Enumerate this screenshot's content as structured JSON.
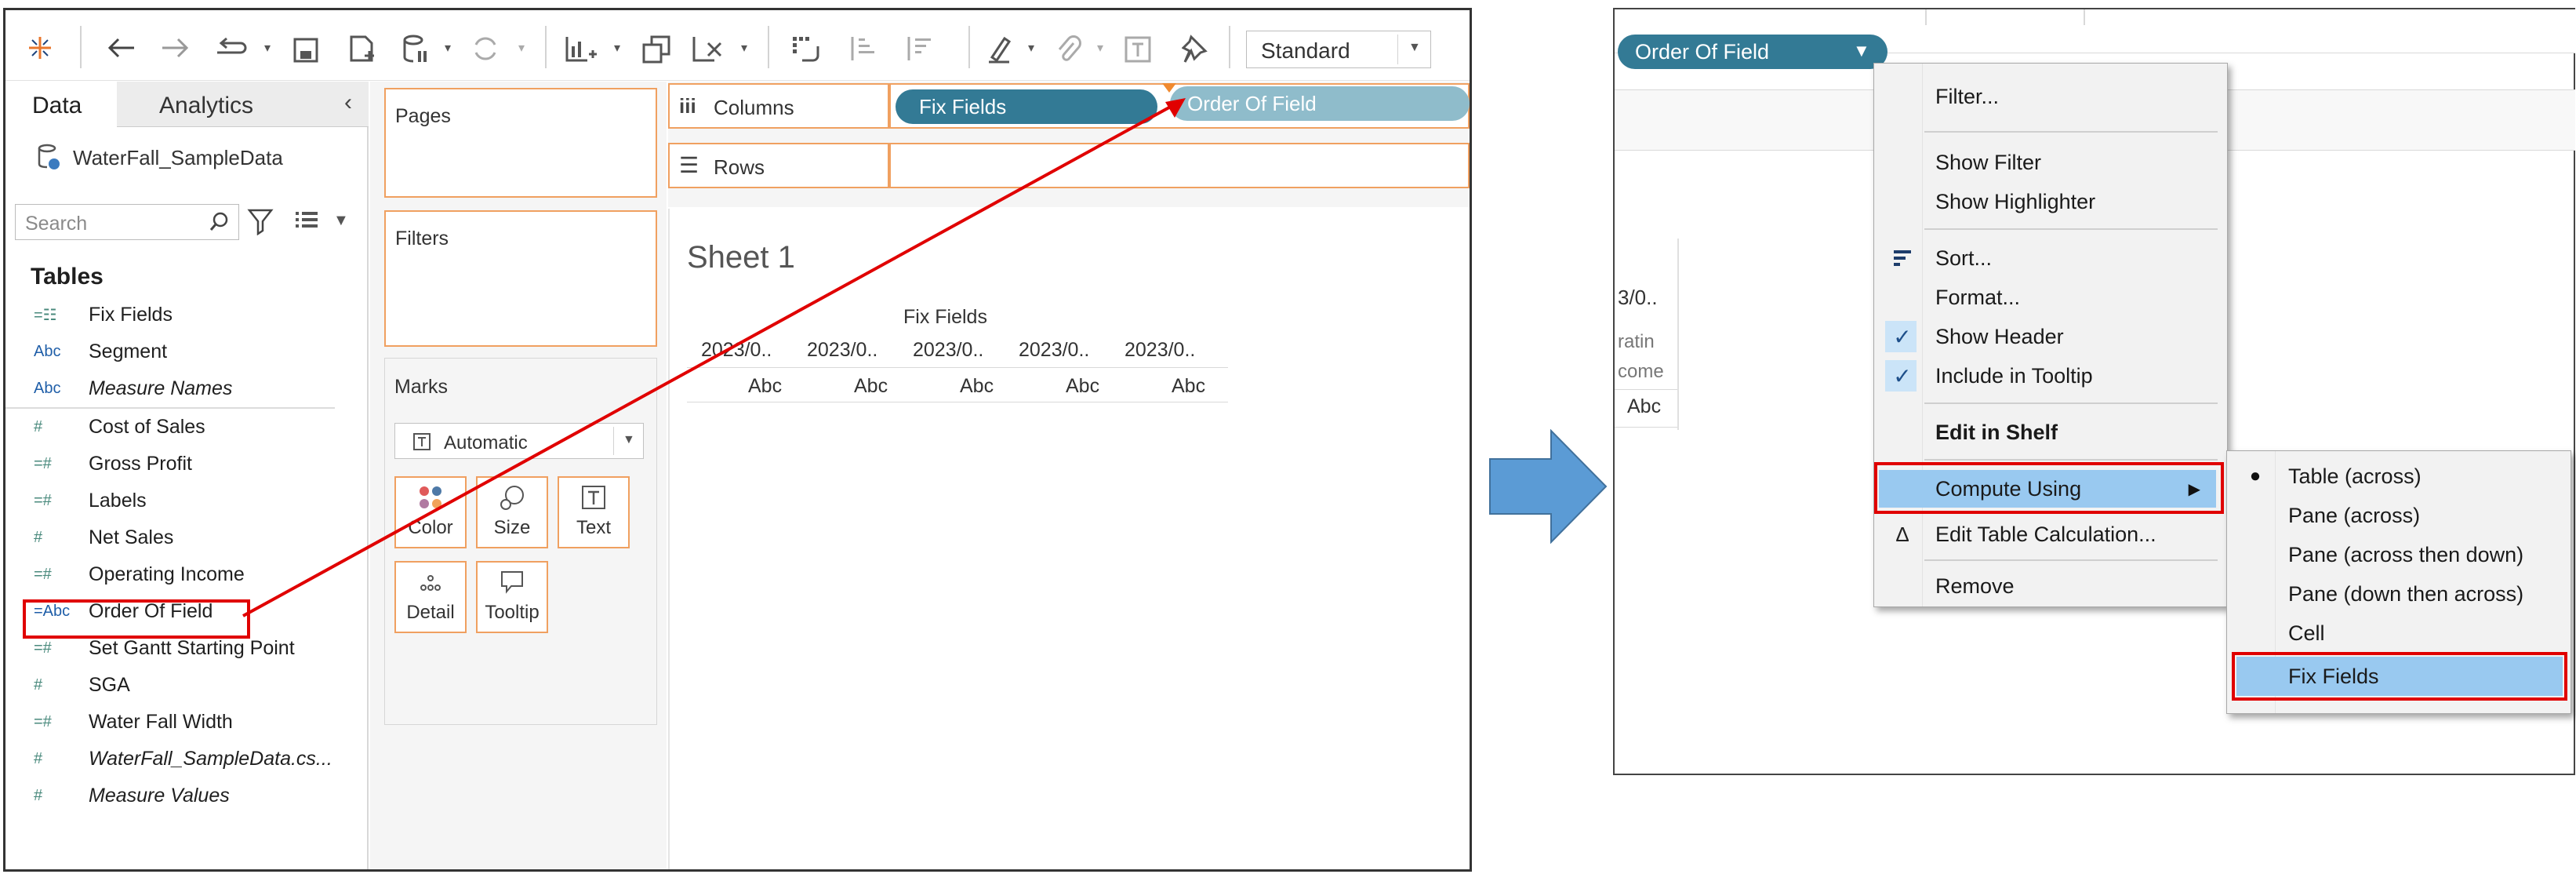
{
  "left_window": {
    "toolbar": {
      "view_select": "Standard",
      "icons": [
        "tableau-logo-icon",
        "back-icon",
        "forward-icon",
        "redo-icon",
        "save-icon",
        "new-datasource-icon",
        "pause-icon",
        "refresh-icon",
        "new-sheet-icon",
        "duplicate-icon",
        "clear-icon",
        "swap-icon",
        "sort-asc-icon",
        "sort-desc-icon",
        "highlight-icon",
        "paperclip-icon",
        "label-icon",
        "pin-icon"
      ]
    },
    "data_pane": {
      "tabs": [
        "Data",
        "Analytics"
      ],
      "datasource": "WaterFall_SampleData",
      "search_placeholder": "Search",
      "tables_heading": "Tables",
      "fields": [
        {
          "icon": "=☷",
          "name": "Fix Fields"
        },
        {
          "icon": "Abc",
          "name": "Segment"
        },
        {
          "icon": "Abc",
          "name": "Measure Names"
        },
        {
          "icon": "#",
          "name": "Cost of Sales"
        },
        {
          "icon": "=#",
          "name": "Gross Profit"
        },
        {
          "icon": "=#",
          "name": "Labels"
        },
        {
          "icon": "#",
          "name": "Net Sales"
        },
        {
          "icon": "=#",
          "name": "Operating Income"
        },
        {
          "icon": "=Abc",
          "name": "Order Of Field"
        },
        {
          "icon": "=#",
          "name": "Set Gantt Starting Point"
        },
        {
          "icon": "#",
          "name": "SGA"
        },
        {
          "icon": "=#",
          "name": "Water Fall Width"
        },
        {
          "icon": "#",
          "name": "WaterFall_SampleData.cs..."
        },
        {
          "icon": "#",
          "name": "Measure Values"
        }
      ]
    },
    "cards": {
      "pages": "Pages",
      "filters": "Filters",
      "marks": "Marks",
      "mark_type": "Automatic",
      "mark_buttons": [
        "Color",
        "Size",
        "Text",
        "Detail",
        "Tooltip"
      ]
    },
    "shelves": {
      "columns_label": "Columns",
      "rows_label": "Rows",
      "columns_pill": "Fix Fields",
      "dragged_pill": "Order Of Field"
    },
    "sheet": {
      "title": "Sheet 1",
      "header": "Fix Fields",
      "col_headers": [
        "2023/0..",
        "2023/0..",
        "2023/0..",
        "2023/0..",
        "2023/0.."
      ],
      "cells": [
        "Abc",
        "Abc",
        "Abc",
        "Abc",
        "Abc"
      ]
    }
  },
  "right_window": {
    "pill": "Order Of Field",
    "partial_header": [
      "3/0..",
      "ratin",
      "come"
    ],
    "partial_cell": "Abc",
    "context_menu": {
      "items": [
        "Filter...",
        "Show Filter",
        "Show Highlighter",
        "Sort...",
        "Format...",
        "Show Header",
        "Include in Tooltip",
        "Edit in Shelf",
        "Compute Using",
        "Edit Table Calculation...",
        "Remove"
      ],
      "checked": [
        "Show Header",
        "Include in Tooltip"
      ]
    },
    "submenu": {
      "items": [
        "Table (across)",
        "Pane (across)",
        "Pane (across then down)",
        "Pane (down then across)",
        "Cell",
        "Fix Fields"
      ],
      "selected": "Table (across)",
      "highlighted": "Fix Fields"
    }
  },
  "colors": {
    "pill": "#337a95",
    "dragged_pill": "#8fbccb",
    "shelf_border": "#f0a060",
    "highlight": "#99c9f0",
    "annotation": "#e00000",
    "arrow": "#5b9bd5"
  }
}
